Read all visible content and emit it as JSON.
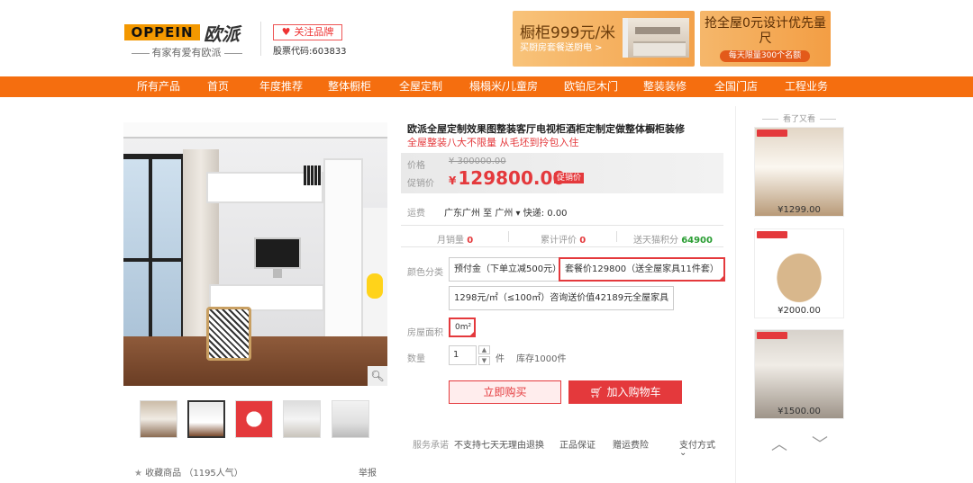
{
  "header": {
    "logo_text": "OPPEIN",
    "logo_cn": "欧派",
    "slogan": "有家有爱有欧派",
    "follow_label": "关注品牌",
    "stock_code": "股票代码:603833",
    "ad1_title": "橱柜999元/米",
    "ad1_sub": "买厨房套餐送厨电 >",
    "ad2_title": "抢全屋0元设计优先量尺",
    "ad2_badge": "每天限量300个名额"
  },
  "nav": [
    "所有产品",
    "首页",
    "年度推荐",
    "整体橱柜",
    "全屋定制",
    "榻榻米/儿童房",
    "欧铂尼木门",
    "整装装修",
    "全国门店",
    "工程业务"
  ],
  "gallery": {
    "zoom_icon": "magnifier-icon",
    "fav_label": "收藏商品",
    "fav_count": "（1195人气）",
    "report_label": "举报"
  },
  "product": {
    "title": "欧派全屋定制效果图整装客厅电视柜酒柜定制定做整体橱柜装修",
    "subtitle": "全屋整装八大不限量 从毛坯到拎包入住",
    "price_label": "价格",
    "original_price": "¥ 300000.00",
    "promo_label": "促销价",
    "currency": "¥",
    "promo_price": "129800.00",
    "promo_tag": "促销价",
    "ship_label": "运费",
    "ship_value": "广东广州 至 广州 ▾ 快递: 0.00",
    "monthly_sales_label": "月销量",
    "monthly_sales": "0",
    "reviews_label": "累计评价",
    "reviews": "0",
    "points_label": "送天猫积分",
    "points": "64900",
    "color_label": "颜色分类",
    "options": [
      "预付金（下单立减500元）",
      "套餐价129800（送全屋家具11件套）",
      "1298元/㎡（≤100㎡）咨询送价值42189元全屋家具"
    ],
    "area_label": "房屋面积",
    "area_option": "0m²",
    "qty_label": "数量",
    "qty_value": "1",
    "unit": "件",
    "stock": "库存1000件",
    "buy_now": "立即购买",
    "add_cart": "加入购物车",
    "cart_icon": "cart-icon",
    "service_label": "服务承诺",
    "services": [
      "不支持七天无理由退换",
      "正品保证",
      "赠运费险"
    ],
    "pay_label": "支付方式"
  },
  "sidebar": {
    "title": "看了又看",
    "prices": [
      "¥1299.00",
      "¥2000.00",
      "¥1500.00"
    ],
    "up_icon": "chevron-up-icon",
    "down_icon": "chevron-down-icon"
  },
  "colors": {
    "accent": "#f56e0f",
    "red": "#e4393c",
    "green": "#2a9d33"
  }
}
